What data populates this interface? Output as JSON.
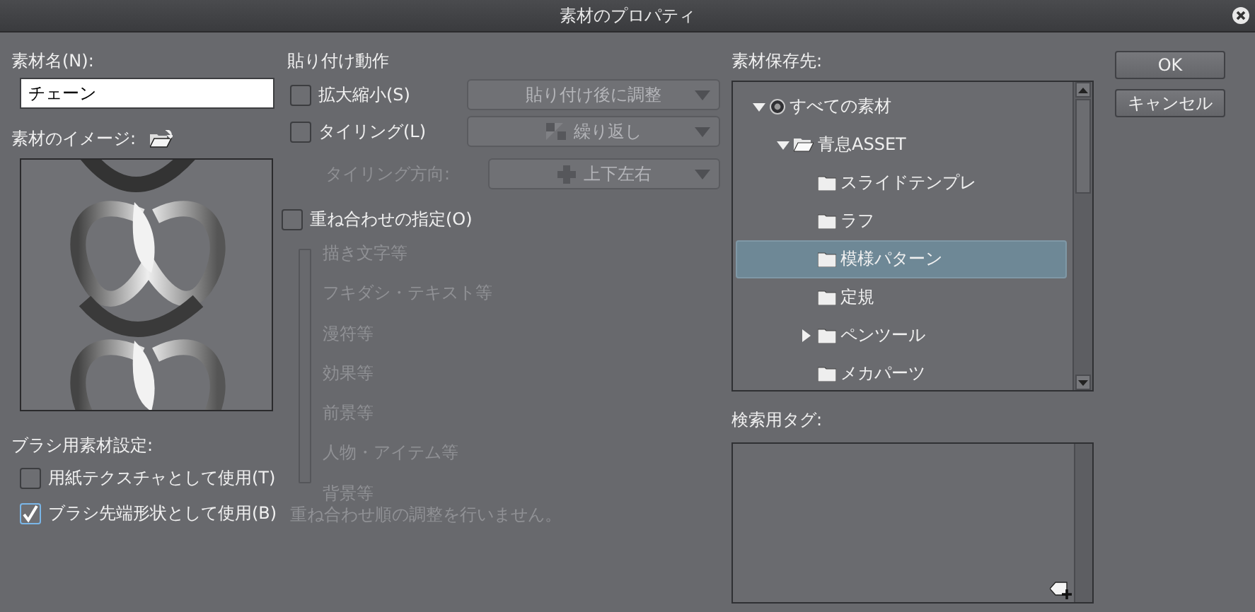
{
  "window": {
    "title": "素材のプロパティ"
  },
  "material_name": {
    "label": "素材名(N):",
    "value": "チェーン"
  },
  "material_image": {
    "label": "素材のイメージ:"
  },
  "brush_settings": {
    "label": "ブラシ用素材設定:",
    "options": [
      {
        "label": "用紙テクスチャとして使用(T)",
        "checked": false
      },
      {
        "label": "ブラシ先端形状として使用(B)",
        "checked": true
      }
    ]
  },
  "paste": {
    "label": "貼り付け動作",
    "scale": {
      "label": "拡大縮小(S)",
      "checked": false,
      "value": "貼り付け後に調整",
      "disabled": true
    },
    "tiling": {
      "label": "タイリング(L)",
      "checked": false,
      "value": "繰り返し",
      "disabled": true
    },
    "tiling_direction": {
      "label": "タイリング方向:",
      "value": "上下左右",
      "disabled": true
    }
  },
  "layering": {
    "label": "重ね合わせの指定(O)",
    "checked": false,
    "disabled": true,
    "items": [
      "描き文字等",
      "フキダシ・テキスト等",
      "漫符等",
      "効果等",
      "前景等",
      "人物・アイテム等",
      "背景等"
    ],
    "note": "重ね合わせ順の調整を行いません。"
  },
  "save_location": {
    "label": "素材保存先:",
    "tree": [
      {
        "label": "すべての素材",
        "kind": "root",
        "expanded": true,
        "selected": false,
        "children": [
          {
            "label": "青息ASSET",
            "kind": "folder",
            "expanded": true,
            "selected": false,
            "children": [
              {
                "label": "スライドテンプレ",
                "kind": "folder",
                "selected": false
              },
              {
                "label": "ラフ",
                "kind": "folder",
                "selected": false
              },
              {
                "label": "模様パターン",
                "kind": "folder",
                "selected": true
              },
              {
                "label": "定規",
                "kind": "folder",
                "selected": false
              },
              {
                "label": "ペンツール",
                "kind": "folder",
                "expanded": false,
                "selected": false
              },
              {
                "label": "メカパーツ",
                "kind": "folder",
                "selected": false
              }
            ]
          }
        ]
      }
    ]
  },
  "search_tags": {
    "label": "検索用タグ:"
  },
  "buttons": [
    {
      "label": "OK"
    },
    {
      "label": "キャンセル"
    }
  ]
}
